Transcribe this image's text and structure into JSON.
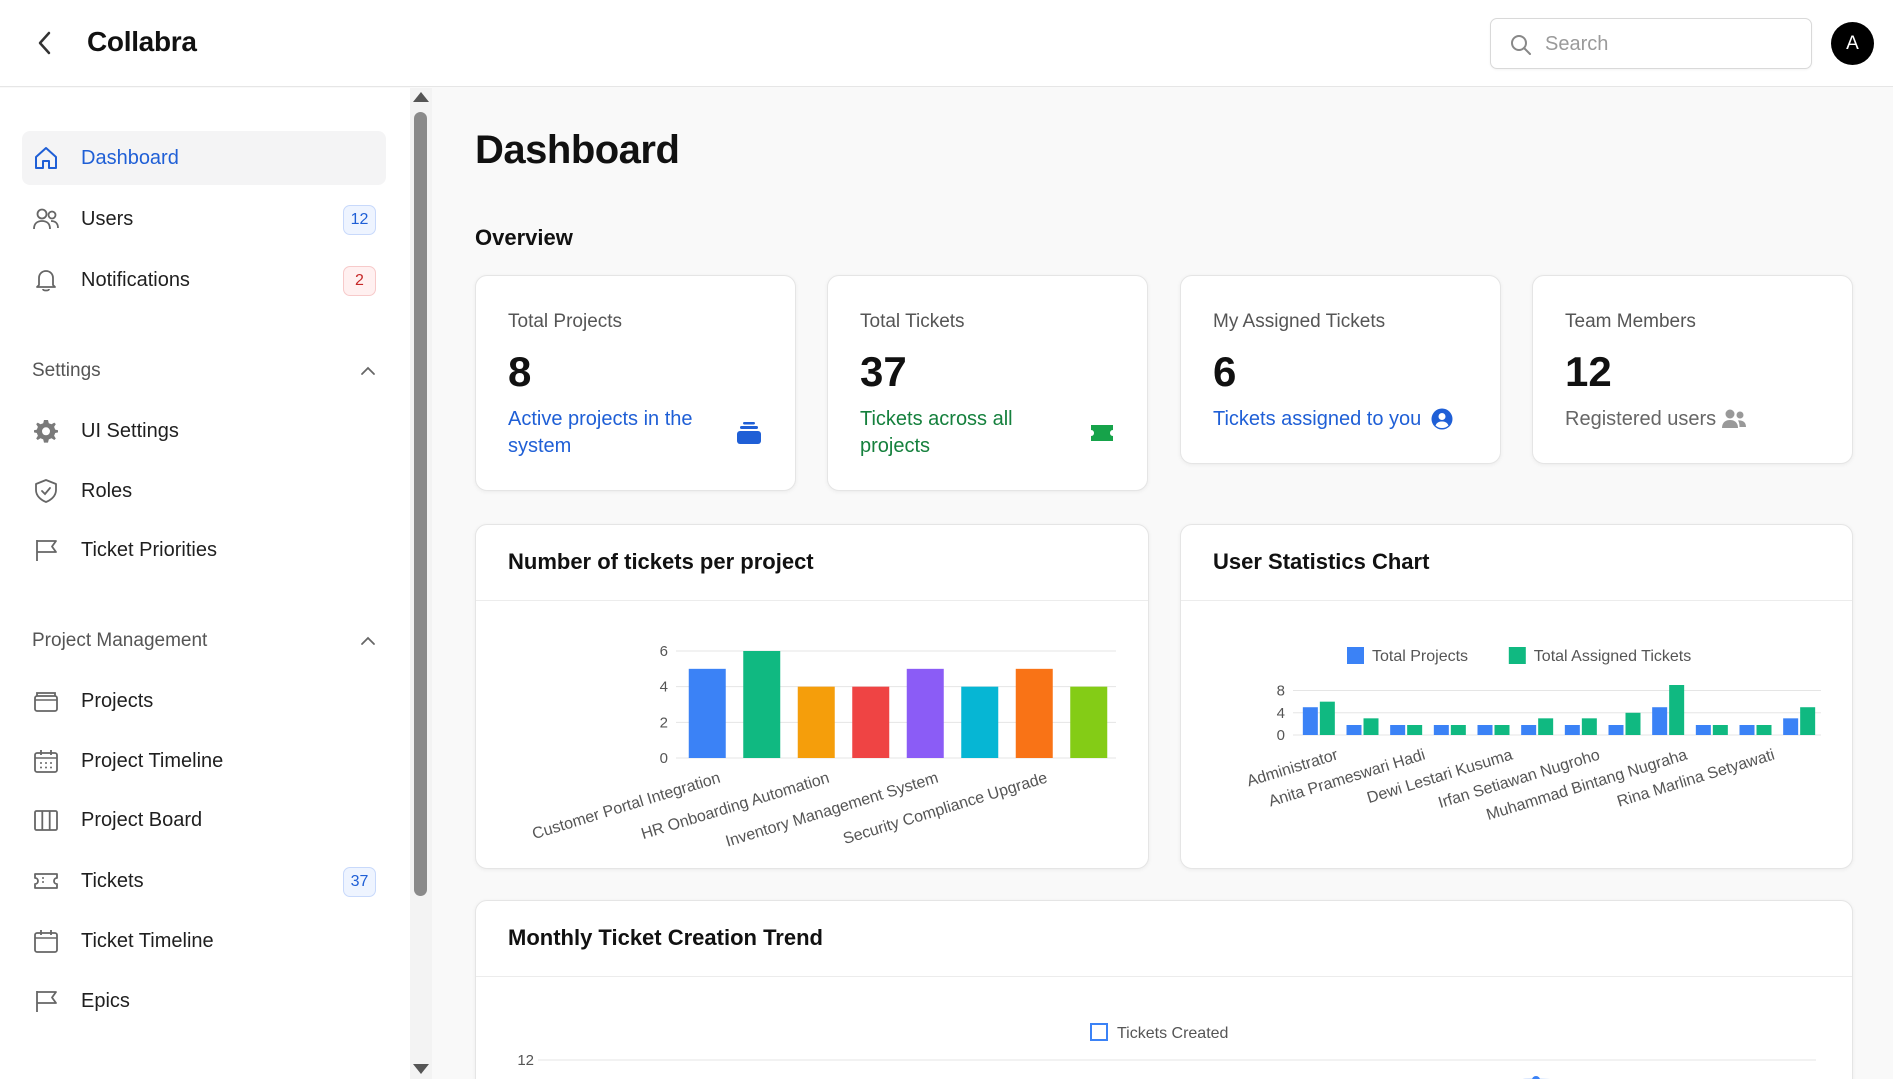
{
  "app": {
    "title": "Collabra",
    "avatar_initial": "A"
  },
  "search": {
    "placeholder": "Search"
  },
  "sidebar": {
    "items": [
      {
        "label": "Dashboard",
        "icon": "home-icon",
        "active": true
      },
      {
        "label": "Users",
        "icon": "users-icon",
        "badge": "12"
      },
      {
        "label": "Notifications",
        "icon": "bell-icon",
        "badge": "2"
      }
    ],
    "settings": {
      "label": "Settings",
      "items": [
        {
          "label": "UI Settings",
          "icon": "gear-icon"
        },
        {
          "label": "Roles",
          "icon": "shield-icon"
        },
        {
          "label": "Ticket Priorities",
          "icon": "flag-icon"
        }
      ]
    },
    "project_management": {
      "label": "Project Management",
      "items": [
        {
          "label": "Projects",
          "icon": "folder-icon"
        },
        {
          "label": "Project Timeline",
          "icon": "calendar-icon"
        },
        {
          "label": "Project Board",
          "icon": "board-icon"
        },
        {
          "label": "Tickets",
          "icon": "ticket-icon",
          "badge": "37"
        },
        {
          "label": "Ticket Timeline",
          "icon": "calendar-icon"
        },
        {
          "label": "Epics",
          "icon": "flag-icon"
        }
      ]
    }
  },
  "main": {
    "title": "Dashboard",
    "overview_label": "Overview",
    "stats": [
      {
        "label": "Total Projects",
        "value": "8",
        "desc": "Active projects in the system",
        "color": "#1f5fd6",
        "icon": "stack-icon"
      },
      {
        "label": "Total Tickets",
        "value": "37",
        "desc": "Tickets across all projects",
        "color": "#15803d",
        "icon": "ticket-icon"
      },
      {
        "label": "My Assigned Tickets",
        "value": "6",
        "desc": "Tickets assigned to you",
        "color": "#1f5fd6",
        "icon": "user-circle-icon"
      },
      {
        "label": "Team Members",
        "value": "12",
        "desc": "Registered users",
        "color": "#666666",
        "icon": "users-icon"
      }
    ]
  },
  "chart_data": [
    {
      "type": "bar",
      "title": "Number of tickets per project",
      "categories": [
        "Customer Portal Integration",
        "",
        "HR Onboarding Automation",
        "",
        "Inventory Management System",
        "",
        "Security Compliance Upgrade",
        ""
      ],
      "values": [
        5,
        6,
        4,
        4,
        5,
        4,
        5,
        4
      ],
      "colors": [
        "#3b82f6",
        "#10b981",
        "#f59e0b",
        "#ef4444",
        "#8b5cf6",
        "#06b6d4",
        "#f97316",
        "#84cc16"
      ],
      "yticks": [
        0,
        2,
        4,
        6
      ],
      "ylim": [
        0,
        6
      ],
      "grid": true
    },
    {
      "type": "bar",
      "title": "User Statistics Chart",
      "categories": [
        "Administrator",
        "",
        "Anita Prameswari Hadi",
        "",
        "Dewi Lestari Kusuma",
        "",
        "Irfan Setiawan Nugroho",
        "",
        "Muhammad Bintang Nugraha",
        "",
        "Rina Marlina Setyawati",
        ""
      ],
      "series": [
        {
          "name": "Total Projects",
          "color": "#3b82f6",
          "values": [
            5,
            1.8,
            1.8,
            1.8,
            1.8,
            1.8,
            1.8,
            1.8,
            5,
            1.8,
            1.8,
            3
          ]
        },
        {
          "name": "Total Assigned Tickets",
          "color": "#10b981",
          "values": [
            6,
            3,
            1.8,
            1.8,
            1.8,
            3,
            3,
            4,
            9,
            1.8,
            1.8,
            5
          ]
        }
      ],
      "yticks": [
        0,
        4,
        8
      ],
      "ylim": [
        0,
        9
      ],
      "legend": "top",
      "grid": true
    },
    {
      "type": "line",
      "title": "Monthly Ticket Creation Trend",
      "series": [
        {
          "name": "Tickets Created",
          "color": "#3b82f6"
        }
      ],
      "yticks": [
        12
      ],
      "legend": "top",
      "grid": true
    }
  ]
}
